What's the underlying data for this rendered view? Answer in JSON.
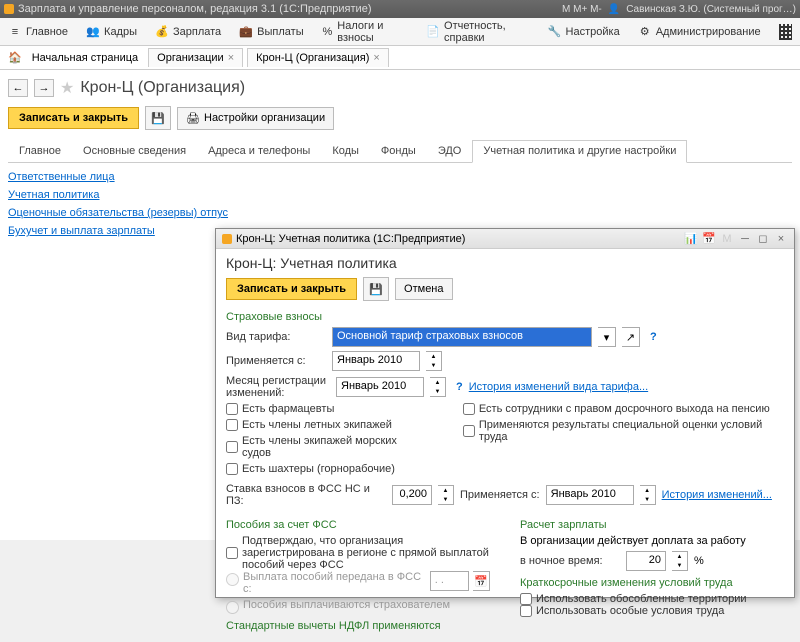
{
  "titlebar": {
    "title": "Зарплата и управление персоналом, редакция 3.1  (1С:Предприятие)",
    "user": "Савинская З.Ю. (Системный прог…)",
    "m_labels": "М  М+  М-"
  },
  "toolbar": {
    "items": [
      "Главное",
      "Кадры",
      "Зарплата",
      "Выплаты",
      "Налоги и взносы",
      "Отчетность, справки",
      "Настройка",
      "Администрирование"
    ]
  },
  "tabs": {
    "home": "Начальная страница",
    "t1": "Организации",
    "t2": "Крон-Ц (Организация)"
  },
  "page": {
    "title": "Крон-Ц (Организация)",
    "save_close": "Записать и закрыть",
    "org_settings": "Настройки организации"
  },
  "inner_tabs": [
    "Главное",
    "Основные сведения",
    "Адреса и телефоны",
    "Коды",
    "Фонды",
    "ЭДО",
    "Учетная политика и другие настройки"
  ],
  "links": [
    "Ответственные лица",
    "Учетная политика",
    "Оценочные обязательства (резервы) отпус",
    "Бухучет и выплата зарплаты"
  ],
  "modal": {
    "title": "Крон-Ц: Учетная политика  (1С:Предприятие)",
    "header": "Крон-Ц: Учетная политика",
    "save_close": "Записать и закрыть",
    "cancel": "Отмена",
    "sec_insurance": "Страховые взносы",
    "tariff_label": "Вид тарифа:",
    "tariff_value": "Основной тариф страховых взносов",
    "applies_from": "Применяется с:",
    "applies_val": "Январь 2010",
    "reg_month": "Месяц регистрации изменений:",
    "reg_val": "Январь 2010",
    "history_link": "История изменений вида тарифа...",
    "checks_left": [
      "Есть фармацевты",
      "Есть члены летных экипажей",
      "Есть члены экипажей морских судов",
      "Есть шахтеры (горнорабочие)"
    ],
    "checks_right": [
      "Есть сотрудники с правом досрочного выхода на пенсию",
      "Применяются результаты специальной оценки условий труда"
    ],
    "fss_rate_label": "Ставка взносов в ФСС НС и ПЗ:",
    "fss_rate": "0,200",
    "applies_from2": "Применяется с:",
    "applies_val2": "Январь 2010",
    "history2": "История изменений...",
    "sec_fss": "Пособия за счет ФСС",
    "fss_confirm": "Подтверждаю, что организация зарегистрирована в регионе с прямой выплатой пособий через ФСС",
    "fss_radio1": "Выплата пособий передана в ФСС с:",
    "fss_radio2": "Пособия выплачиваются страхователем",
    "sec_ndfl": "Стандартные вычеты НДФЛ применяются",
    "sec_salary": "Расчет зарплаты",
    "salary_text": "В организации действует доплата за работу",
    "night_label": "в ночное время:",
    "night_val": "20",
    "sec_short": "Краткосрочные изменения условий труда",
    "short_check1": "Использовать обособленные территории",
    "short_check2": "Использовать особые условия труда"
  }
}
